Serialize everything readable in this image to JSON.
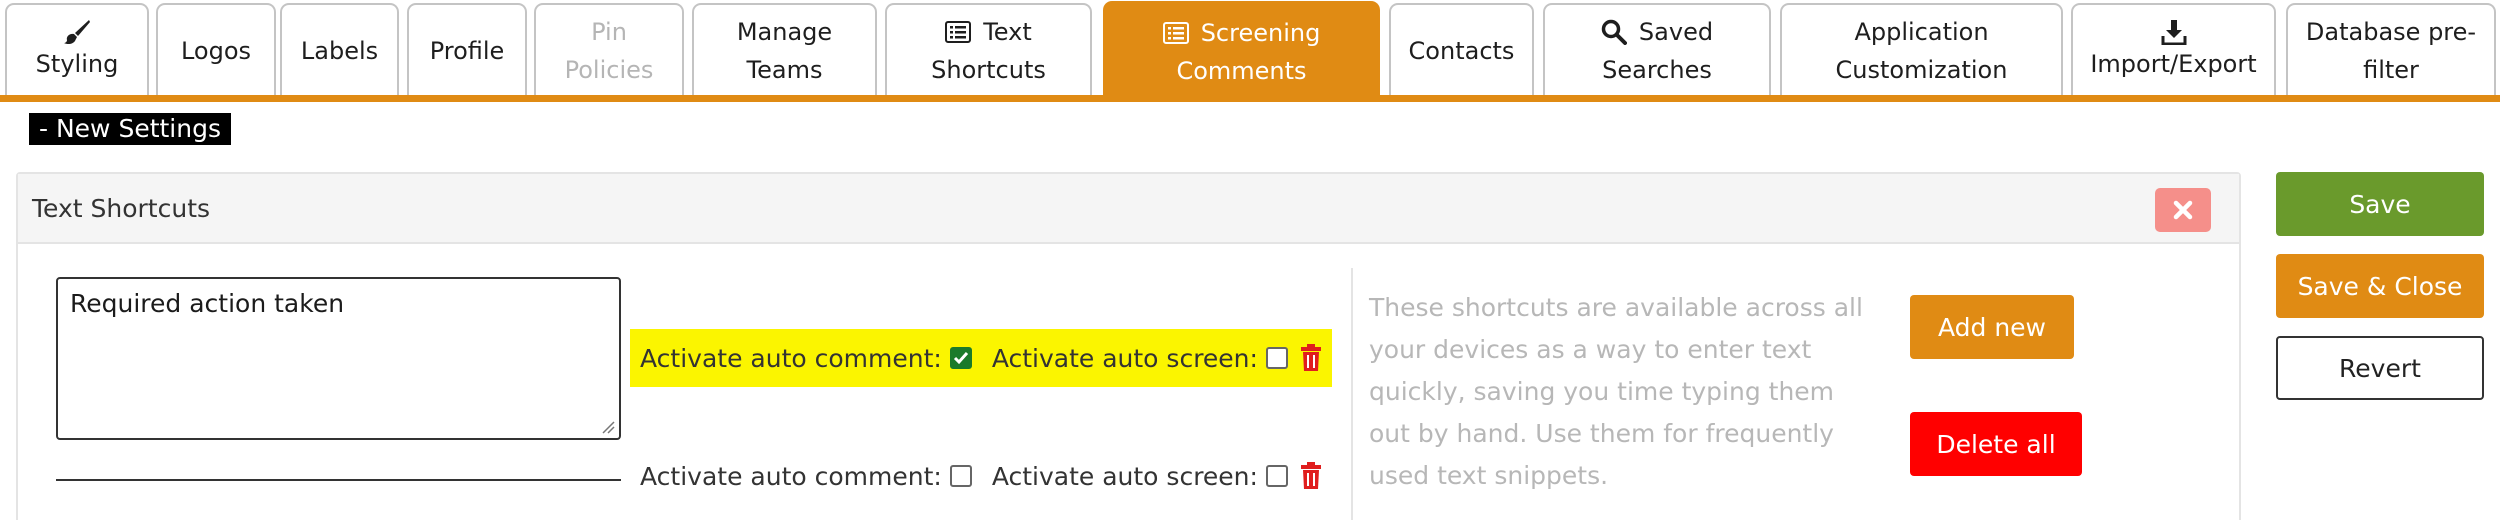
{
  "tabs": [
    {
      "label": "Styling",
      "icon": "paintbrush-icon"
    },
    {
      "label": "Logos"
    },
    {
      "label": "Labels"
    },
    {
      "label": "Profile"
    },
    {
      "label_line1": "Pin",
      "label_line2": "Policies",
      "state": "disabled"
    },
    {
      "label_line1": "Manage",
      "label_line2": "Teams"
    },
    {
      "label_line1": "Text",
      "label_line2": "Shortcuts",
      "icon": "list-icon"
    },
    {
      "label_line1": "Screening",
      "label_line2": "Comments",
      "icon": "list-icon",
      "state": "active"
    },
    {
      "label": "Contacts"
    },
    {
      "label_line1": "Saved",
      "label_line2": "Searches",
      "icon": "search-icon"
    },
    {
      "label_line1": "Application",
      "label_line2": "Customization"
    },
    {
      "label": "Import/Export",
      "icon": "download-icon"
    },
    {
      "label_line1": "Database pre-",
      "label_line2": "filter"
    }
  ],
  "new_settings_label": "- New Settings",
  "panel": {
    "title": "Text Shortcuts"
  },
  "shortcuts": [
    {
      "text": "Required action taken",
      "auto_comment_label": "Activate auto comment:",
      "auto_comment_checked": true,
      "auto_screen_label": "Activate auto screen:",
      "auto_screen_checked": false
    },
    {
      "text": "",
      "auto_comment_label": "Activate auto comment:",
      "auto_comment_checked": false,
      "auto_screen_label": "Activate auto screen:",
      "auto_screen_checked": false
    }
  ],
  "help_text": "These shortcuts are available across all your devices as a way to enter text quickly, saving you time typing them out by hand. Use them for frequently used text snippets.",
  "buttons": {
    "add_new": "Add new",
    "delete_all": "Delete all",
    "save": "Save",
    "save_close": "Save & Close",
    "revert": "Revert"
  },
  "colors": {
    "accent": "#e08b14",
    "save": "#6a9a2c",
    "danger": "#ff0000",
    "highlight": "#fbf500",
    "close": "#f58f8a"
  }
}
